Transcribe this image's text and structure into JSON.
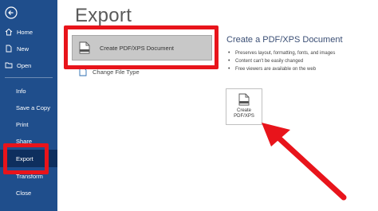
{
  "sidebar": {
    "items": [
      {
        "label": "Home",
        "icon": "home-icon"
      },
      {
        "label": "New",
        "icon": "new-doc-icon"
      },
      {
        "label": "Open",
        "icon": "folder-open-icon"
      },
      {
        "label": "Info"
      },
      {
        "label": "Save a Copy"
      },
      {
        "label": "Print"
      },
      {
        "label": "Share"
      },
      {
        "label": "Export"
      },
      {
        "label": "Transform"
      },
      {
        "label": "Close"
      }
    ],
    "back_icon": "back-arrow-icon",
    "background": "#1f4e8c"
  },
  "main": {
    "title": "Export",
    "options": [
      {
        "label": "Create PDF/XPS Document",
        "icon": "pdf-document-icon"
      },
      {
        "label": "Change File Type",
        "icon": "change-file-type-icon"
      }
    ],
    "detail": {
      "title": "Create a PDF/XPS Document",
      "bullets": [
        "Preserves layout, formatting, fonts, and images",
        "Content can't be easily changed",
        "Free viewers are available on the web"
      ],
      "button_line1": "Create",
      "button_line2": "PDF/XPS"
    }
  },
  "annotation": {
    "highlight_color": "#e8141b"
  }
}
